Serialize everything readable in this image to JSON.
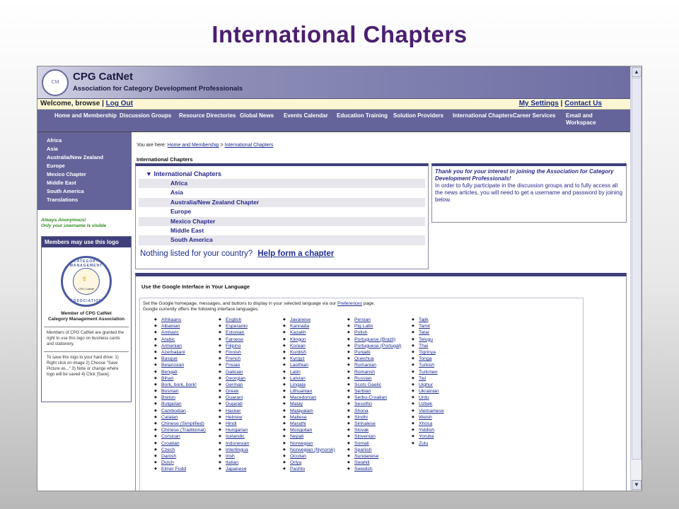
{
  "slide_title": "International Chapters",
  "header": {
    "brand": "CPG CatNet",
    "tagline": "Association for Category Development Professionals"
  },
  "welcome": {
    "greeting": "Welcome, browse |",
    "logout": "Log Out",
    "my_settings": "My Settings",
    "separator": "|",
    "contact": "Contact Us"
  },
  "nav": [
    {
      "label": "Home and Membership"
    },
    {
      "label": "Discussion Groups"
    },
    {
      "label": "Resource Directories"
    },
    {
      "label": "Global News"
    },
    {
      "label": "Events Calendar"
    },
    {
      "label": "Education Training"
    },
    {
      "label": "Solution Providers"
    },
    {
      "label": "International Chapters"
    },
    {
      "label": "Career Services"
    },
    {
      "label": "Email and Workspace"
    }
  ],
  "sidebar": [
    "Africa",
    "Asia",
    "Australia/New Zealand",
    "Europe",
    "Mexico Chapter",
    "Middle East",
    "South America",
    "Translations"
  ],
  "anon": {
    "line1": "Always Anonymous!",
    "line2": "Only your username is visible"
  },
  "member_box": {
    "header": "Members may use this logo",
    "seal_top": "CATEGORY MANAGEMENT",
    "seal_bottom": "ASSOCIATION",
    "seal_word": "CPG CatNet",
    "caption1": "Member of CPG CatNet",
    "caption2": "Category Management Association",
    "text1": "Members of CPG CatNet are granted the right to use this logo on business cards and stationery.",
    "text2": "To save this logo to your hard drive: 1) Right click on image 2) Choose \"Save Picture as...\" 3) Note or change where logo will be saved 4) Click [Save]."
  },
  "breadcrumb": {
    "prefix": "You are here:",
    "home": "Home and Membership",
    "sep": ">",
    "current": "International Chapters"
  },
  "section_title": "International Chapters",
  "chapters": {
    "heading": "International Chapters",
    "items": [
      "Africa",
      "Asia",
      "Australia/New Zealand Chapter",
      "Europe",
      "Mexico Chapter",
      "Middle East",
      "South America"
    ],
    "nothing_text": "Nothing listed for your country?",
    "help_link": "Help form a chapter"
  },
  "thanks": {
    "italic": "Thank you for your interest in joining the Association for Category Development Professionals!",
    "body": "In order to fully participate in the discussion groups and to fully access all the news articles, you will need to get a username and password by joining below."
  },
  "google": {
    "title": "Use the Google Interface in Your Language",
    "desc1": "Set the Google homepage, messages, and buttons to display in your selected language via our",
    "pref_link": "Preferences",
    "desc1_end": "page.",
    "desc2": "Google currently offers the following interface languages:",
    "columns": [
      [
        "Afrikaans",
        "Albanian",
        "Amharic",
        "Arabic",
        "Armenian",
        "Azerbaijani",
        "Basque",
        "Belarusian",
        "Bengali",
        "Bihari",
        "Bork, bork, bork!",
        "Bosnian",
        "Breton",
        "Bulgarian",
        "Cambodian",
        "Catalan",
        "Chinese (Simplified)",
        "Chinese (Traditional)",
        "Corsican",
        "Croatian",
        "Czech",
        "Danish",
        "Dutch",
        "Elmer Fudd"
      ],
      [
        "English",
        "Esperanto",
        "Estonian",
        "Faroese",
        "Filipino",
        "Finnish",
        "French",
        "Frisian",
        "Galician",
        "Georgian",
        "German",
        "Greek",
        "Guarani",
        "Gujarati",
        "Hacker",
        "Hebrew",
        "Hindi",
        "Hungarian",
        "Icelandic",
        "Indonesian",
        "Interlingua",
        "Irish",
        "Italian",
        "Japanese"
      ],
      [
        "Javanese",
        "Kannada",
        "Kazakh",
        "Klingon",
        "Korean",
        "Kurdish",
        "Kyrgyz",
        "Laothian",
        "Latin",
        "Latvian",
        "Lingala",
        "Lithuanian",
        "Macedonian",
        "Malay",
        "Malayalam",
        "Maltese",
        "Marathi",
        "Mongolian",
        "Nepali",
        "Norwegian",
        "Norwegian (Nynorsk)",
        "Occitan",
        "Oriya",
        "Pashto"
      ],
      [
        "Persian",
        "Pig Latin",
        "Polish",
        "Portuguese (Brazil)",
        "Portuguese (Portugal)",
        "Punjabi",
        "Quechua",
        "Romanian",
        "Romansh",
        "Russian",
        "Scots Gaelic",
        "Serbian",
        "Serbo-Croatian",
        "Sesotho",
        "Shona",
        "Sindhi",
        "Sinhalese",
        "Slovak",
        "Slovenian",
        "Somali",
        "Spanish",
        "Sundanese",
        "Swahili",
        "Swedish"
      ],
      [
        "Tajik",
        "Tamil",
        "Tatar",
        "Telugu",
        "Thai",
        "Tigrinya",
        "Tonga",
        "Turkish",
        "Turkmen",
        "Twi",
        "Uighur",
        "Ukrainian",
        "Urdu",
        "Uzbek",
        "Vietnamese",
        "Welsh",
        "Xhosa",
        "Yiddish",
        "Yoruba",
        "Zulu"
      ]
    ]
  }
}
